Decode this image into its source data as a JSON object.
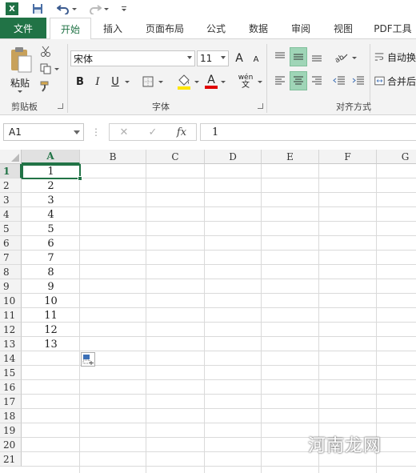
{
  "app": {
    "logo": "X"
  },
  "tabs": {
    "file": "文件",
    "home": "开始",
    "insert": "插入",
    "page_layout": "页面布局",
    "formulas": "公式",
    "data": "数据",
    "review": "审阅",
    "view": "视图",
    "pdf": "PDF工具"
  },
  "ribbon": {
    "clipboard": {
      "paste_label": "粘贴",
      "group_label": "剪贴板"
    },
    "font": {
      "font_name": "宋体",
      "font_size": "11",
      "grow": "A",
      "shrink": "A",
      "bold": "B",
      "italic": "I",
      "underline": "U",
      "font_color_letter": "A",
      "phonetic": "wén",
      "group_label": "字体"
    },
    "alignment": {
      "wrap_text": "自动换",
      "merge_center": "合并后",
      "group_label": "对齐方式"
    }
  },
  "formula_bar": {
    "name_box": "A1",
    "cancel": "✕",
    "enter": "✓",
    "fx": "fx",
    "value": "1"
  },
  "sheet": {
    "columns": [
      "A",
      "B",
      "C",
      "D",
      "E",
      "F",
      "G"
    ],
    "rows": [
      "1",
      "2",
      "3",
      "4",
      "5",
      "6",
      "7",
      "8",
      "9",
      "10",
      "11",
      "12",
      "13",
      "14",
      "15",
      "16",
      "17",
      "18",
      "19",
      "20",
      "21"
    ],
    "column_a_values": [
      "1",
      "2",
      "3",
      "4",
      "5",
      "6",
      "7",
      "8",
      "9",
      "10",
      "11",
      "12",
      "13"
    ],
    "selected_cell": "A1"
  },
  "watermark": "河南龙网",
  "colors": {
    "accent": "#217346",
    "ribbon_bg": "#f3f3f3",
    "highlight": "#9fd5b7"
  }
}
